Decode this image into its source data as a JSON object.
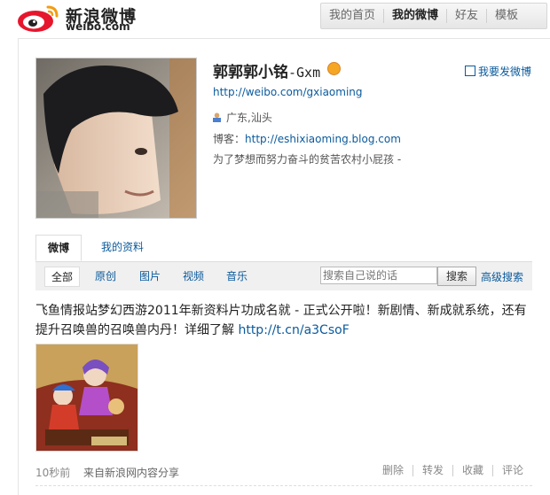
{
  "logo": {
    "cn": "新浪微博",
    "en": "weibo.com"
  },
  "topnav": [
    "我的首页",
    "我的微博",
    "好友",
    "模板"
  ],
  "profile": {
    "name": "郭郭郭小铭",
    "name_suffix": "-Gxm",
    "post_link": "我要发微博",
    "url": "http://weibo.com/gxiaoming",
    "location": "广东,汕头",
    "blog_label": "博客：",
    "blog_url": "http://eshixiaoming.blog.com",
    "bio": "为了梦想而努力奋斗的贫苦农村小屁孩 -"
  },
  "tabs": [
    "微博",
    "我的资料"
  ],
  "filters": [
    "全部",
    "原创",
    "图片",
    "视频",
    "音乐"
  ],
  "search": {
    "placeholder": "搜索自己说的话",
    "button": "搜索",
    "advanced": "高级搜索"
  },
  "post": {
    "text": "飞鱼情报站梦幻西游2011年新资料片功成名就 - 正式公开啦！新剧情、新成就系统，还有提升召唤兽的召唤兽内丹！详细了解 ",
    "link": "http://t.cn/a3CsoF",
    "time": "10秒前",
    "source": "来自新浪网内容分享",
    "actions": [
      "删除",
      "转发",
      "收藏",
      "评论"
    ]
  },
  "colors": {
    "link": "#0a5a9c",
    "weibo_red": "#e6162d"
  }
}
